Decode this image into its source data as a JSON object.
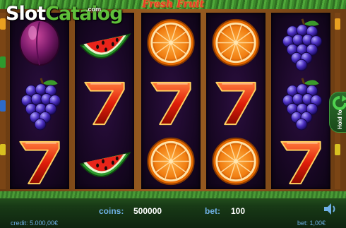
{
  "game": {
    "title": "Fresh Fruit"
  },
  "watermark": {
    "brand_left": "Slot",
    "brand_right": "Catalog",
    "suffix": ".com"
  },
  "reels": [
    [
      "plum",
      "grapes",
      "seven"
    ],
    [
      "watermelon",
      "seven",
      "watermelon"
    ],
    [
      "orange",
      "seven",
      "orange"
    ],
    [
      "orange",
      "seven",
      "orange"
    ],
    [
      "grapes",
      "grapes",
      "seven"
    ]
  ],
  "hold_button": {
    "label": "Hold fo",
    "icon": "circular-arrow-icon"
  },
  "status": {
    "coins_label": "coins:",
    "coins_value": "500000",
    "bet_label": "bet:",
    "bet_value": "100",
    "credit": "credit: 5.000,00€",
    "bet_money": "bet: 1,00€"
  },
  "colors": {
    "label_blue": "#6fb0e6",
    "reel_bg": "#180724",
    "frame_wood": "#9c5f22"
  }
}
